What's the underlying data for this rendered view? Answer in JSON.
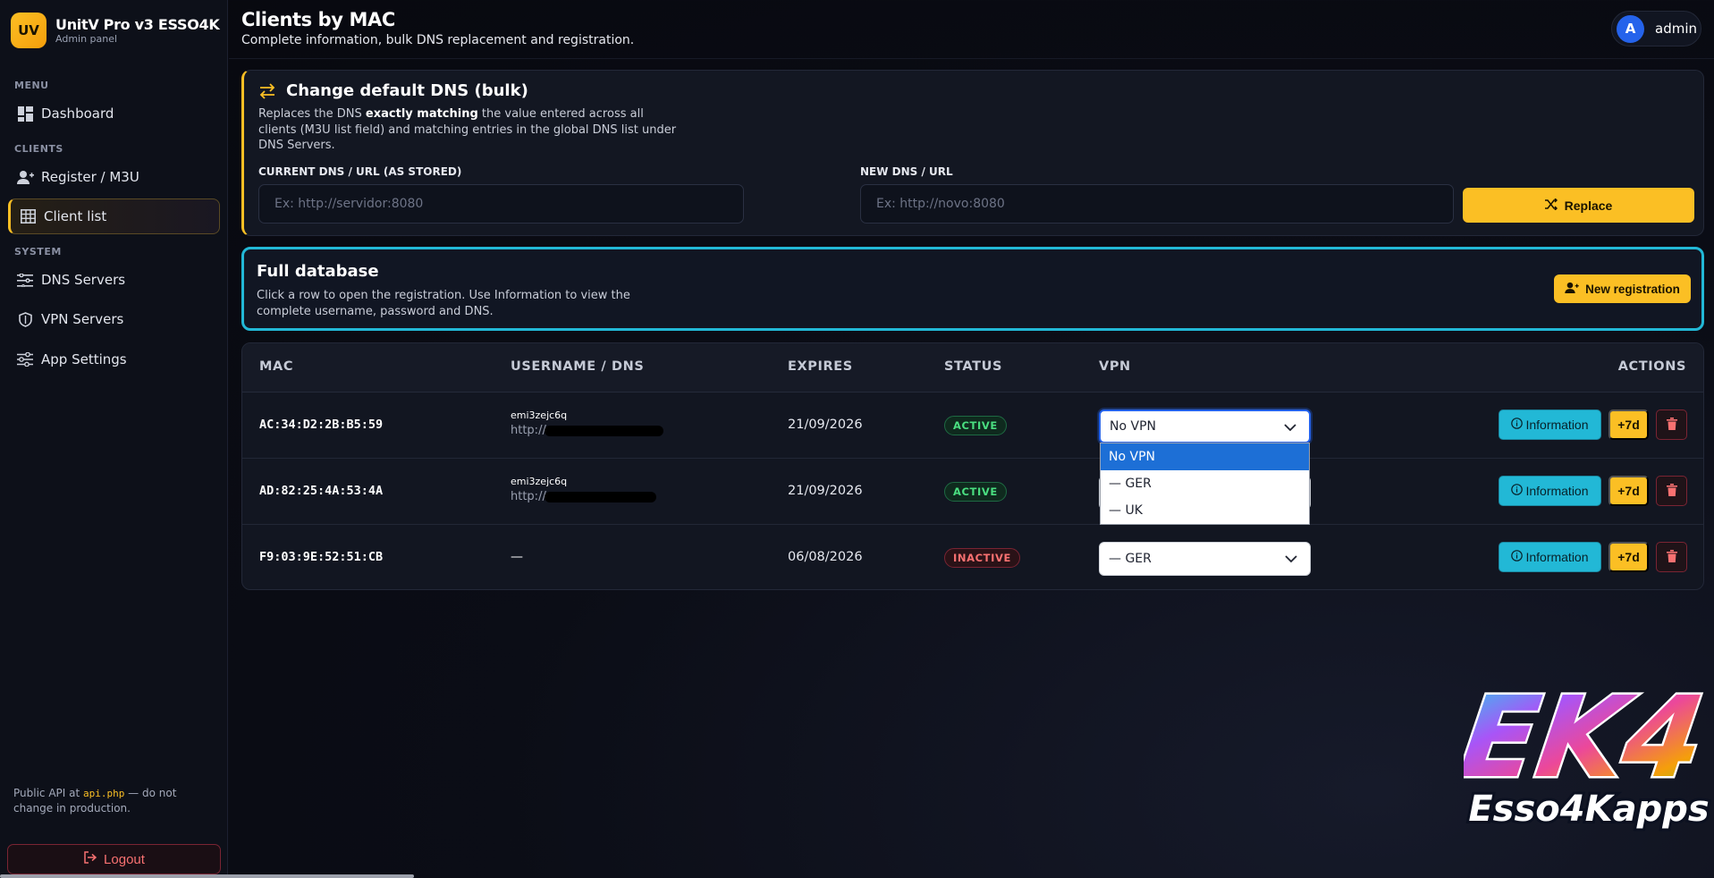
{
  "brand": {
    "logo": "UV",
    "title": "UnitV Pro v3 ESSO4K",
    "subtitle": "Admin panel"
  },
  "sidebar": {
    "sections": [
      "MENU",
      "CLIENTS",
      "SYSTEM"
    ],
    "items": [
      {
        "label": "Dashboard",
        "icon": "dashboard-icon"
      },
      {
        "label": "Register / M3U",
        "icon": "user-plus-icon"
      },
      {
        "label": "Client list",
        "icon": "table-icon",
        "active": true
      },
      {
        "label": "DNS Servers",
        "icon": "server-icon"
      },
      {
        "label": "VPN Servers",
        "icon": "shield-icon"
      },
      {
        "label": "App Settings",
        "icon": "sliders-icon"
      }
    ],
    "api_note_prefix": "Public API at ",
    "api_note_code": "api.php",
    "api_note_suffix": " — do not change in production.",
    "logout": "Logout"
  },
  "header": {
    "title": "Clients by MAC",
    "subtitle": "Complete information, bulk DNS replacement and registration.",
    "user_initial": "A",
    "user_name": "admin"
  },
  "dns_card": {
    "title": "Change default DNS (bulk)",
    "desc_before": "Replaces the DNS ",
    "desc_bold": "exactly matching",
    "desc_after": " the value entered across all clients (M3U list field) and matching entries in the global DNS list under DNS Servers.",
    "current_label": "CURRENT DNS / URL (AS STORED)",
    "current_placeholder": "Ex: http://servidor:8080",
    "new_label": "NEW DNS / URL",
    "new_placeholder": "Ex: http://novo:8080",
    "replace_label": "Replace"
  },
  "db_card": {
    "title": "Full database",
    "desc": "Click a row to open the registration. Use Information to view the complete username, password and DNS.",
    "new_label": "New registration"
  },
  "table": {
    "headers": [
      "MAC",
      "USERNAME / DNS",
      "EXPIRES",
      "STATUS",
      "VPN",
      "ACTIONS"
    ],
    "rows": [
      {
        "mac": "AC:34:D2:2B:B5:59",
        "username": "emi3zejc6q",
        "dns": "http://",
        "expires": "21/09/2026",
        "status": "ACTIVE",
        "vpn": "No VPN"
      },
      {
        "mac": "AD:82:25:4A:53:4A",
        "username": "emi3zejc6q",
        "dns": "http://",
        "expires": "21/09/2026",
        "status": "ACTIVE",
        "vpn": ""
      },
      {
        "mac": "F9:03:9E:52:51:CB",
        "username": "—",
        "dns": "",
        "expires": "06/08/2026",
        "status": "INACTIVE",
        "vpn": "— GER"
      }
    ],
    "info_label": "Information",
    "extend_label": "+7d"
  },
  "vpn_dropdown": {
    "options": [
      "No VPN",
      "— GER",
      "— UK"
    ],
    "selected": "No VPN"
  },
  "logo_text": {
    "top": "EK4",
    "bottom": "Esso4Kapps"
  },
  "colors": {
    "accent": "#fbbf24",
    "cyan": "#22b8d6",
    "danger": "#f87171",
    "success": "#4ade80",
    "select_blue": "#1d6fd6"
  }
}
